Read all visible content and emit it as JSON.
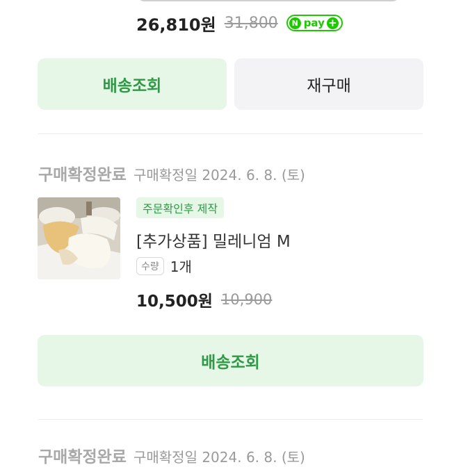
{
  "top_item": {
    "sale_price": "26,810원",
    "original_price": "31,800",
    "npay_label": "pay",
    "npay_icon": "naverpay-badge-icon"
  },
  "top_buttons": {
    "track_label": "배송조회",
    "reorder_label": "재구매"
  },
  "order": {
    "status": "구매확정완료",
    "date": "구매확정일 2024. 6. 8. (토)",
    "badge": "주문확인후 제작",
    "title": "[추가상품] 밀레니엄 M",
    "qty_label": "수량",
    "qty_value": "1개",
    "sale_price": "10,500원",
    "original_price": "10,900",
    "track_label": "배송조회"
  },
  "next_order": {
    "status": "구매확정완료",
    "date": "구매확정일 2024. 6. 8. (토)"
  },
  "colors": {
    "accent_green": "#2e9a46",
    "accent_bg": "#e6f7e8",
    "naverpay_green": "#1ec800"
  }
}
